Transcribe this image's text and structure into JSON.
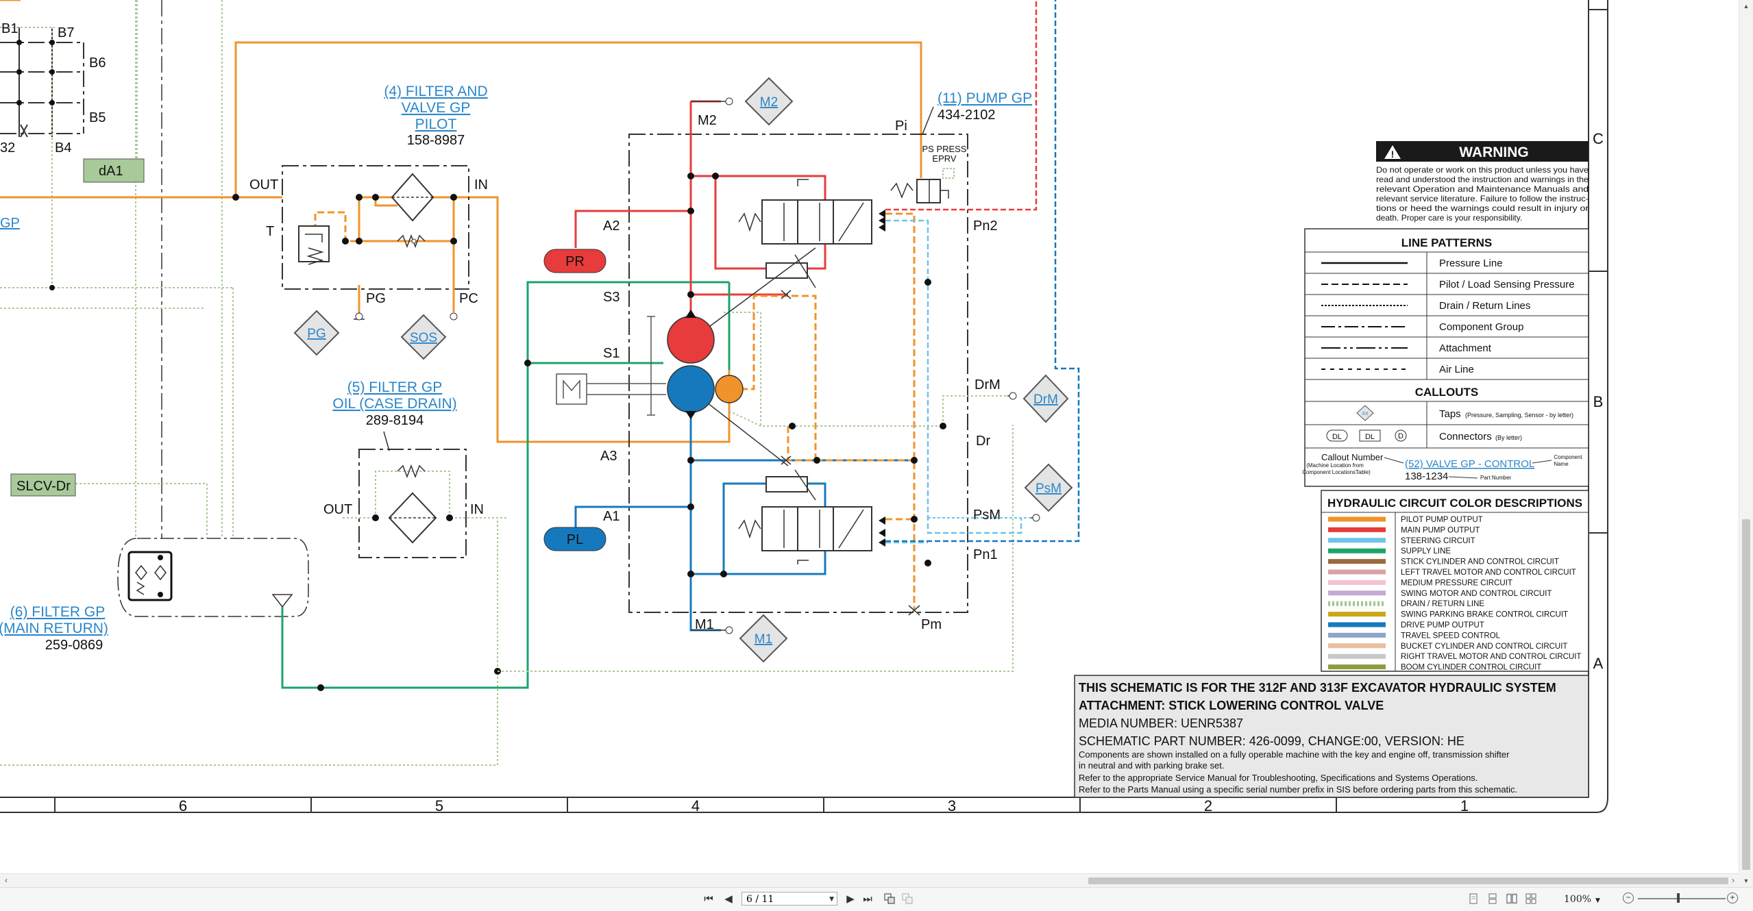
{
  "components": {
    "filter_pilot": {
      "title": [
        "(4) FILTER AND",
        "VALVE GP",
        "PILOT"
      ],
      "part": "158-8987"
    },
    "filter_case": {
      "title": [
        "(5) FILTER GP",
        "OIL (CASE DRAIN)"
      ],
      "part": "289-8194"
    },
    "filter_return": {
      "title": [
        "(6) FILTER GP",
        "(MAIN RETURN)"
      ],
      "part": "259-0869"
    },
    "pump": {
      "title": "(11) PUMP GP",
      "part": "434-2102"
    },
    "ps_press": [
      "PS PRESS",
      "EPRV"
    ]
  },
  "labels": {
    "b1": "B1",
    "b7": "B7",
    "b6": "B6",
    "b5": "B5",
    "b4": "B4",
    "b2": "32",
    "da1": "dA1",
    "gp": "GP",
    "slcv": "SLCV-Dr",
    "out": "OUT",
    "in": "IN",
    "t": "T",
    "pg": "PG",
    "pc": "PC",
    "a2": "A2",
    "a3": "A3",
    "a1": "A1",
    "s3": "S3",
    "s1": "S1",
    "m1": "M1",
    "m2": "M2",
    "pi": "Pi",
    "pn2": "Pn2",
    "pn1": "Pn1",
    "drm": "DrM",
    "dr": "Dr",
    "psm": "PsM",
    "pm": "Pm",
    "pr": "PR",
    "pl": "PL"
  },
  "taps": {
    "pg": "PG",
    "sos": "SOS",
    "m2": "M2",
    "m1": "M1",
    "drm": "DrM",
    "psm": "PsM"
  },
  "zones": {
    "rows": [
      "C",
      "B",
      "A"
    ],
    "cols": [
      "6",
      "5",
      "4",
      "3",
      "2",
      "1"
    ]
  },
  "warning": {
    "title": "WARNING",
    "lines": [
      "Do not operate or work on this product unless you have",
      "read and understood the instruction and warnings in the",
      "relevant Operation and Maintenance Manuals and",
      "relevant service literature. Failure to follow the instruc-",
      "tions or heed the warnings could result in injury or",
      "death. Proper care is your responsibility."
    ]
  },
  "line_patterns": {
    "title": "LINE PATTERNS",
    "items": [
      {
        "label": "Pressure Line",
        "dash": ""
      },
      {
        "label": "Pilot / Load Sensing Pressure",
        "dash": "10,5"
      },
      {
        "label": "Drain / Return Lines",
        "dash": "3,2"
      },
      {
        "label": "Component Group",
        "dash": "20,5,4,5"
      },
      {
        "label": "Attachment",
        "dash": "28,5,4,5,4,5"
      },
      {
        "label": "Air Line",
        "dash": "6,7"
      }
    ],
    "callouts_title": "CALLOUTS",
    "taps_label": "Taps",
    "taps_note": "(Pressure, Sampling, Sensor - by letter)",
    "connectors_label": "Connectors",
    "connectors_note": "(By letter)",
    "connector_sym": [
      "DL",
      "DL",
      "D"
    ],
    "tap_sym": "XX",
    "callout_number": "Callout Number",
    "callout_sub": [
      "(Machine Location from",
      "Component LocationsTable)"
    ],
    "callout_link": "(52) VALVE GP - CONTROL",
    "callout_part": "138-1234",
    "component": "Component",
    "name": "Name",
    "part_number": "Part Number"
  },
  "color_desc": {
    "title": "HYDRAULIC CIRCUIT COLOR DESCRIPTIONS",
    "items": [
      {
        "label": "PILOT PUMP OUTPUT",
        "color": "#f0932b",
        "dotted": false
      },
      {
        "label": "MAIN PUMP OUTPUT",
        "color": "#e83b3b",
        "dotted": false
      },
      {
        "label": "STEERING CIRCUIT",
        "color": "#6ec3e6",
        "dotted": false
      },
      {
        "label": "SUPPLY LINE",
        "color": "#1ca36a",
        "dotted": false
      },
      {
        "label": "STICK CYLINDER AND CONTROL CIRCUIT",
        "color": "#9b6a3c",
        "dotted": false
      },
      {
        "label": "LEFT TRAVEL MOTOR AND CONTROL CIRCUIT",
        "color": "#d9a3a3",
        "dotted": false
      },
      {
        "label": "MEDIUM PRESSURE CIRCUIT",
        "color": "#f2c3d1",
        "dotted": false
      },
      {
        "label": "SWING MOTOR AND CONTROL CIRCUIT",
        "color": "#c4a9d4",
        "dotted": false
      },
      {
        "label": "DRAIN / RETURN LINE",
        "color": "#9dc78a",
        "dotted": true
      },
      {
        "label": "SWING PARKING BRAKE CONTROL CIRCUIT",
        "color": "#c8a818",
        "dotted": false
      },
      {
        "label": "DRIVE PUMP OUTPUT",
        "color": "#1679be",
        "dotted": false
      },
      {
        "label": "TRAVEL SPEED CONTROL",
        "color": "#8ca6c8",
        "dotted": false
      },
      {
        "label": "BUCKET CYLINDER AND CONTROL CIRCUIT",
        "color": "#e8bfa0",
        "dotted": false
      },
      {
        "label": "RIGHT TRAVEL MOTOR AND CONTROL CIRCUIT",
        "color": "#c8c8c8",
        "dotted": false
      },
      {
        "label": "BOOM CYLINDER CONTROL CIRCUIT",
        "color": "#8c9e3c",
        "dotted": false
      }
    ]
  },
  "title_block": {
    "line1": "THIS SCHEMATIC IS FOR THE 312F AND 313F EXCAVATOR HYDRAULIC SYSTEM",
    "line2": "ATTACHMENT: STICK LOWERING CONTROL VALVE",
    "line3": "MEDIA NUMBER: UENR5387",
    "line4": "SCHEMATIC PART NUMBER: 426-0099, CHANGE:00, VERSION: HE",
    "notes": [
      "Components are shown installed on a fully operable machine with the key and engine off, transmission shifter",
      "in neutral and with parking brake set.",
      "Refer to the appropriate Service Manual for Troubleshooting, Specifications and Systems Operations.",
      "Refer to the Parts Manual using a specific serial number prefix in SIS before ordering parts from this schematic."
    ]
  },
  "viewer": {
    "page_value": "6 / 11",
    "zoom": "100%",
    "nav": {
      "first": "⏮",
      "prev": "◀",
      "next": "▶",
      "last": "⏭"
    }
  }
}
